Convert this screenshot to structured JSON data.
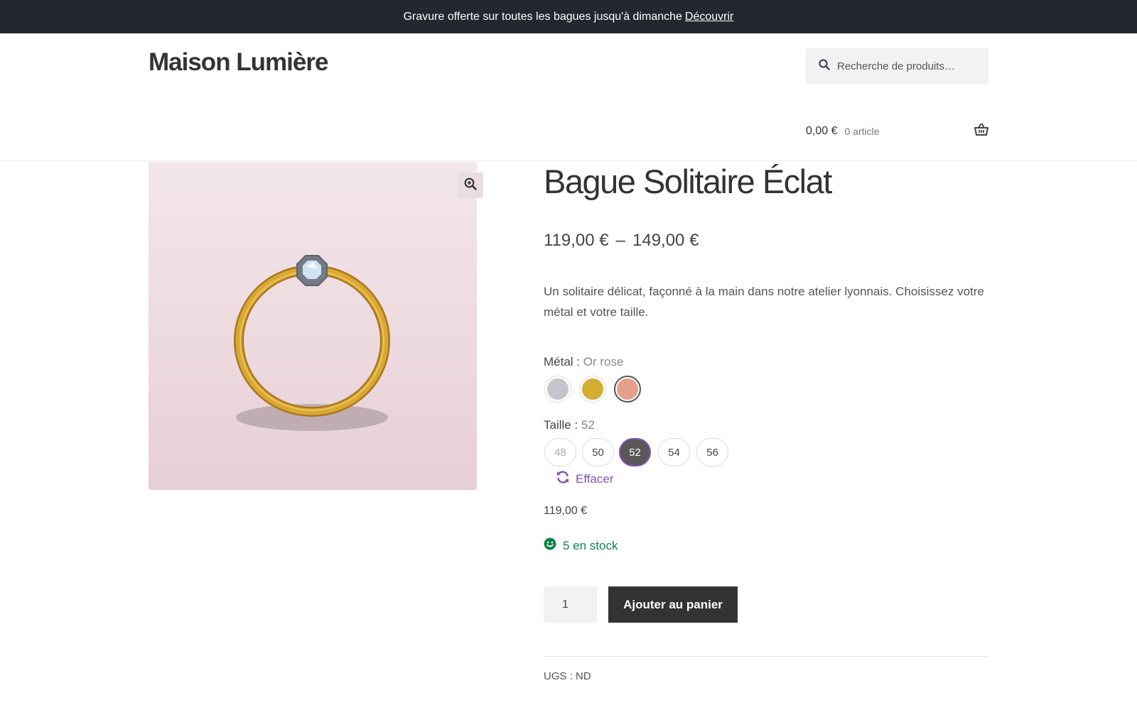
{
  "promo": {
    "message": "Gravure offerte sur toutes les bagues jusqu'à dimanche",
    "link_label": "Découvrir"
  },
  "site": {
    "title": "Maison Lumière"
  },
  "search": {
    "placeholder": "Recherche de produits…",
    "icon": "search-icon"
  },
  "cart": {
    "total": "0,00 €",
    "count": "0 article",
    "icon": "basket-icon"
  },
  "gallery": {
    "zoom_icon": "zoom-in-icon",
    "image": "ring-image",
    "colors": {
      "background_top": "#f3e7ea",
      "background_bottom": "#e7cfd6",
      "band": "#d9a832",
      "stone": "#cfe3f3"
    }
  },
  "product": {
    "title": "Bague Solitaire Éclat",
    "price_min": "119,00 €",
    "price_separator": "–",
    "price_max": "149,00 €",
    "description": "Un solitaire délicat, façonné à la main dans notre atelier lyonnais. Choisissez votre métal et votre taille.",
    "variation_price": "119,00 €",
    "stock": "5 en stock",
    "quantity": "1",
    "add_to_cart_label": "Ajouter au panier",
    "sku_label": "UGS : ND"
  },
  "attributes": {
    "metal": {
      "label": "Métal : ",
      "selected": "Or rose",
      "swatches": [
        {
          "name": "Argent",
          "color": "#c3c6cc"
        },
        {
          "name": "Or jaune",
          "color": "#d4ae32"
        },
        {
          "name": "Or rose",
          "color": "#e4a08a"
        }
      ]
    },
    "size": {
      "label": "Taille : ",
      "selected": "52",
      "options": [
        "48",
        "50",
        "52",
        "54",
        "56"
      ]
    },
    "reset_label": "Effacer"
  },
  "colors": {
    "accent": "#7f54b3",
    "stock": "#0f834d",
    "button": "#333333"
  }
}
